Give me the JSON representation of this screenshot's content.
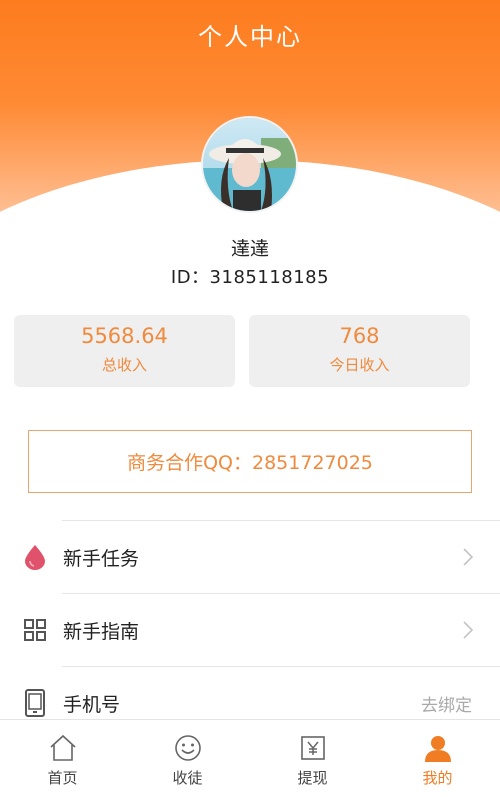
{
  "header": {
    "title": "个人中心"
  },
  "profile": {
    "name": "達達",
    "id_text": "ID：3185118185"
  },
  "stats": [
    {
      "value": "5568.64",
      "label": "总收入"
    },
    {
      "value": "768",
      "label": "今日收入"
    }
  ],
  "cooperation": {
    "text": "商务合作QQ：2851727025"
  },
  "menu": [
    {
      "label": "新手任务",
      "icon": "drop-icon",
      "action": "chevron-right-icon"
    },
    {
      "label": "新手指南",
      "icon": "grid-icon",
      "action": "chevron-right-icon"
    },
    {
      "label": "手机号",
      "icon": "phone-icon",
      "extra": "去绑定"
    }
  ],
  "tabbar": [
    {
      "label": "首页",
      "icon": "home-icon",
      "active": false
    },
    {
      "label": "收徒",
      "icon": "smile-icon",
      "active": false
    },
    {
      "label": "提现",
      "icon": "yen-icon",
      "active": false
    },
    {
      "label": "我的",
      "icon": "user-icon",
      "active": true
    }
  ],
  "colors": {
    "accent": "#f08a3c",
    "header_top": "#fd7c1e",
    "tab_active": "#f07d23",
    "drop_icon": "#e0526b"
  }
}
